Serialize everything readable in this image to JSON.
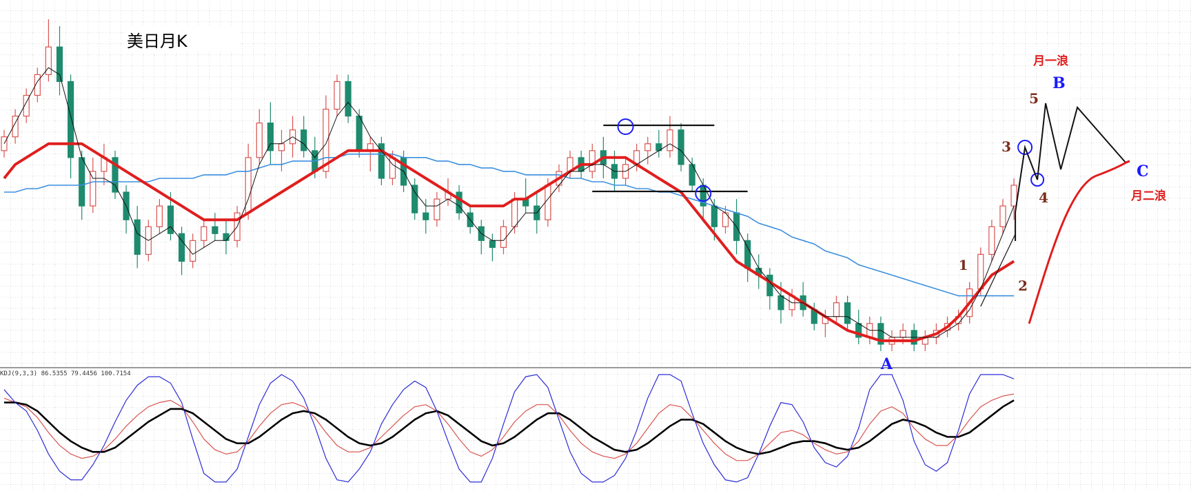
{
  "chart_data": [
    {
      "type": "candlestick",
      "title": "美日月K",
      "grid": true,
      "up_color": "#d9534f",
      "down_color": "#1e8a6e",
      "ylim": [
        0,
        100
      ],
      "candles": [
        [
          60,
          66,
          58,
          64
        ],
        [
          64,
          72,
          62,
          70
        ],
        [
          70,
          78,
          68,
          76
        ],
        [
          76,
          84,
          74,
          82
        ],
        [
          82,
          98,
          80,
          90
        ],
        [
          90,
          96,
          76,
          80
        ],
        [
          80,
          82,
          52,
          58
        ],
        [
          58,
          60,
          40,
          44
        ],
        [
          44,
          58,
          42,
          54
        ],
        [
          54,
          62,
          50,
          58
        ],
        [
          58,
          60,
          46,
          48
        ],
        [
          48,
          50,
          36,
          40
        ],
        [
          40,
          44,
          26,
          30
        ],
        [
          30,
          40,
          28,
          38
        ],
        [
          38,
          46,
          36,
          44
        ],
        [
          44,
          48,
          34,
          36
        ],
        [
          36,
          38,
          24,
          28
        ],
        [
          28,
          36,
          26,
          34
        ],
        [
          34,
          40,
          32,
          38
        ],
        [
          38,
          42,
          34,
          36
        ],
        [
          36,
          40,
          30,
          34
        ],
        [
          34,
          44,
          32,
          42
        ],
        [
          42,
          62,
          40,
          58
        ],
        [
          58,
          72,
          56,
          68
        ],
        [
          68,
          74,
          56,
          60
        ],
        [
          60,
          66,
          54,
          62
        ],
        [
          62,
          70,
          58,
          66
        ],
        [
          66,
          70,
          58,
          60
        ],
        [
          60,
          64,
          52,
          54
        ],
        [
          54,
          76,
          52,
          72
        ],
        [
          72,
          82,
          70,
          80
        ],
        [
          80,
          82,
          68,
          70
        ],
        [
          70,
          72,
          58,
          60
        ],
        [
          60,
          64,
          54,
          62
        ],
        [
          62,
          64,
          50,
          52
        ],
        [
          52,
          60,
          50,
          58
        ],
        [
          58,
          60,
          48,
          50
        ],
        [
          50,
          52,
          40,
          42
        ],
        [
          42,
          46,
          36,
          40
        ],
        [
          40,
          48,
          38,
          46
        ],
        [
          46,
          52,
          44,
          48
        ],
        [
          48,
          50,
          40,
          42
        ],
        [
          42,
          44,
          36,
          38
        ],
        [
          38,
          40,
          30,
          34
        ],
        [
          34,
          36,
          28,
          32
        ],
        [
          32,
          40,
          30,
          38
        ],
        [
          38,
          48,
          36,
          46
        ],
        [
          46,
          52,
          42,
          44
        ],
        [
          44,
          48,
          36,
          40
        ],
        [
          40,
          52,
          38,
          50
        ],
        [
          50,
          56,
          48,
          54
        ],
        [
          54,
          60,
          52,
          58
        ],
        [
          58,
          60,
          52,
          54
        ],
        [
          54,
          62,
          52,
          60
        ],
        [
          60,
          64,
          52,
          56
        ],
        [
          56,
          60,
          48,
          52
        ],
        [
          52,
          58,
          50,
          56
        ],
        [
          56,
          62,
          54,
          60
        ],
        [
          60,
          64,
          56,
          62
        ],
        [
          62,
          66,
          58,
          60
        ],
        [
          60,
          70,
          58,
          66
        ],
        [
          66,
          68,
          54,
          56
        ],
        [
          56,
          58,
          48,
          50
        ],
        [
          50,
          52,
          40,
          44
        ],
        [
          44,
          46,
          34,
          38
        ],
        [
          38,
          44,
          36,
          42
        ],
        [
          42,
          46,
          30,
          34
        ],
        [
          34,
          36,
          22,
          26
        ],
        [
          26,
          30,
          20,
          24
        ],
        [
          24,
          26,
          14,
          18
        ],
        [
          18,
          22,
          10,
          14
        ],
        [
          14,
          20,
          12,
          18
        ],
        [
          18,
          22,
          12,
          14
        ],
        [
          14,
          16,
          8,
          10
        ],
        [
          10,
          14,
          6,
          12
        ],
        [
          12,
          18,
          10,
          16
        ],
        [
          16,
          18,
          8,
          10
        ],
        [
          10,
          14,
          4,
          6
        ],
        [
          6,
          12,
          4,
          10
        ],
        [
          10,
          12,
          2,
          4
        ],
        [
          4,
          8,
          2,
          6
        ],
        [
          6,
          10,
          4,
          8
        ],
        [
          8,
          10,
          2,
          4
        ],
        [
          4,
          8,
          2,
          6
        ],
        [
          6,
          10,
          4,
          8
        ],
        [
          8,
          12,
          6,
          10
        ],
        [
          10,
          14,
          8,
          12
        ],
        [
          12,
          22,
          10,
          20
        ],
        [
          20,
          32,
          18,
          30
        ],
        [
          30,
          40,
          28,
          38
        ],
        [
          38,
          46,
          36,
          44
        ],
        [
          44,
          52,
          40,
          50
        ]
      ],
      "ma_thin": [
        62,
        68,
        74,
        80,
        84,
        82,
        70,
        58,
        52,
        52,
        50,
        44,
        36,
        34,
        36,
        38,
        34,
        30,
        32,
        34,
        34,
        38,
        46,
        56,
        62,
        62,
        64,
        62,
        58,
        62,
        70,
        74,
        70,
        64,
        60,
        56,
        54,
        48,
        44,
        44,
        46,
        44,
        40,
        36,
        34,
        34,
        38,
        42,
        42,
        46,
        50,
        54,
        54,
        56,
        56,
        54,
        54,
        56,
        58,
        60,
        62,
        60,
        56,
        50,
        44,
        42,
        38,
        32,
        26,
        22,
        18,
        16,
        16,
        14,
        12,
        12,
        12,
        10,
        8,
        8,
        6,
        6,
        6,
        6,
        6,
        8,
        10,
        14,
        20,
        28,
        36,
        44
      ],
      "ma_thick": [
        52,
        56,
        58,
        60,
        62,
        62,
        62,
        62,
        60,
        58,
        56,
        54,
        52,
        50,
        48,
        46,
        44,
        42,
        40,
        40,
        40,
        40,
        42,
        44,
        46,
        48,
        50,
        52,
        54,
        56,
        58,
        60,
        60,
        60,
        60,
        58,
        56,
        54,
        52,
        50,
        48,
        46,
        44,
        44,
        44,
        44,
        46,
        46,
        48,
        50,
        52,
        54,
        56,
        56,
        58,
        58,
        58,
        56,
        54,
        52,
        50,
        48,
        44,
        40,
        36,
        32,
        28,
        26,
        24,
        22,
        20,
        18,
        16,
        14,
        12,
        10,
        8,
        7,
        6,
        5,
        5,
        5,
        5,
        6,
        7,
        9,
        12,
        16,
        20,
        24,
        26,
        28
      ],
      "ma_blue": [
        48,
        48,
        49,
        49,
        50,
        50,
        50,
        50,
        51,
        51,
        51,
        51,
        51,
        51,
        52,
        52,
        52,
        52,
        53,
        53,
        53,
        54,
        54,
        55,
        56,
        56,
        57,
        57,
        57,
        58,
        58,
        59,
        59,
        59,
        59,
        59,
        58,
        58,
        58,
        57,
        57,
        56,
        56,
        55,
        55,
        54,
        54,
        53,
        53,
        53,
        53,
        52,
        52,
        51,
        51,
        50,
        50,
        49,
        49,
        48,
        48,
        47,
        46,
        45,
        44,
        43,
        42,
        41,
        39,
        38,
        37,
        35,
        34,
        33,
        31,
        30,
        29,
        27,
        26,
        25,
        24,
        23,
        22,
        21,
        20,
        19,
        18,
        18,
        18,
        18,
        18,
        18
      ],
      "annotations": [
        "A",
        "B",
        "C",
        "1",
        "2",
        "3",
        "4",
        "5",
        "月一浪",
        "月二浪"
      ]
    },
    {
      "type": "line",
      "title": "KDJ(9,3,3) 86.5355 79.4456 100.7154",
      "ylim": [
        0,
        100
      ],
      "series": [
        {
          "name": "K",
          "color": "#d9534f",
          "values": [
            78,
            74,
            70,
            60,
            46,
            34,
            26,
            22,
            24,
            30,
            40,
            52,
            62,
            70,
            74,
            76,
            70,
            56,
            40,
            30,
            26,
            28,
            38,
            52,
            64,
            72,
            74,
            70,
            60,
            46,
            34,
            28,
            28,
            32,
            42,
            52,
            62,
            70,
            72,
            66,
            54,
            40,
            28,
            24,
            30,
            42,
            56,
            66,
            72,
            72,
            62,
            48,
            36,
            28,
            24,
            22,
            26,
            36,
            50,
            64,
            72,
            70,
            60,
            48,
            36,
            26,
            20,
            20,
            26,
            36,
            46,
            48,
            44,
            36,
            30,
            26,
            28,
            38,
            54,
            66,
            70,
            64,
            50,
            40,
            34,
            34,
            44,
            58,
            70,
            76,
            80,
            82
          ]
        },
        {
          "name": "D",
          "color": "#000000",
          "values": [
            74,
            74,
            72,
            66,
            56,
            46,
            38,
            32,
            28,
            28,
            32,
            40,
            48,
            56,
            62,
            68,
            68,
            64,
            56,
            48,
            40,
            36,
            36,
            42,
            50,
            58,
            64,
            66,
            64,
            58,
            50,
            42,
            36,
            34,
            36,
            42,
            50,
            58,
            64,
            66,
            62,
            54,
            46,
            38,
            34,
            36,
            42,
            50,
            58,
            64,
            64,
            58,
            50,
            42,
            36,
            30,
            28,
            30,
            36,
            44,
            52,
            58,
            58,
            54,
            46,
            38,
            32,
            28,
            26,
            28,
            32,
            36,
            38,
            38,
            36,
            32,
            30,
            32,
            38,
            46,
            54,
            58,
            56,
            52,
            46,
            42,
            42,
            46,
            54,
            62,
            70,
            76
          ]
        },
        {
          "name": "J",
          "color": "#2b2bd6",
          "values": [
            86,
            74,
            66,
            48,
            26,
            10,
            2,
            2,
            16,
            34,
            56,
            76,
            90,
            98,
            98,
            92,
            74,
            40,
            8,
            0,
            0,
            12,
            42,
            72,
            92,
            100,
            94,
            78,
            52,
            22,
            2,
            0,
            12,
            28,
            54,
            72,
            86,
            94,
            88,
            66,
            38,
            12,
            0,
            0,
            22,
            54,
            84,
            98,
            100,
            88,
            58,
            28,
            8,
            0,
            0,
            6,
            22,
            48,
            78,
            100,
            100,
            94,
            64,
            36,
            16,
            2,
            0,
            4,
            26,
            52,
            74,
            72,
            56,
            32,
            18,
            14,
            24,
            50,
            86,
            100,
            100,
            76,
            38,
            16,
            10,
            18,
            48,
            82,
            100,
            100,
            100,
            96
          ]
        }
      ]
    }
  ]
}
